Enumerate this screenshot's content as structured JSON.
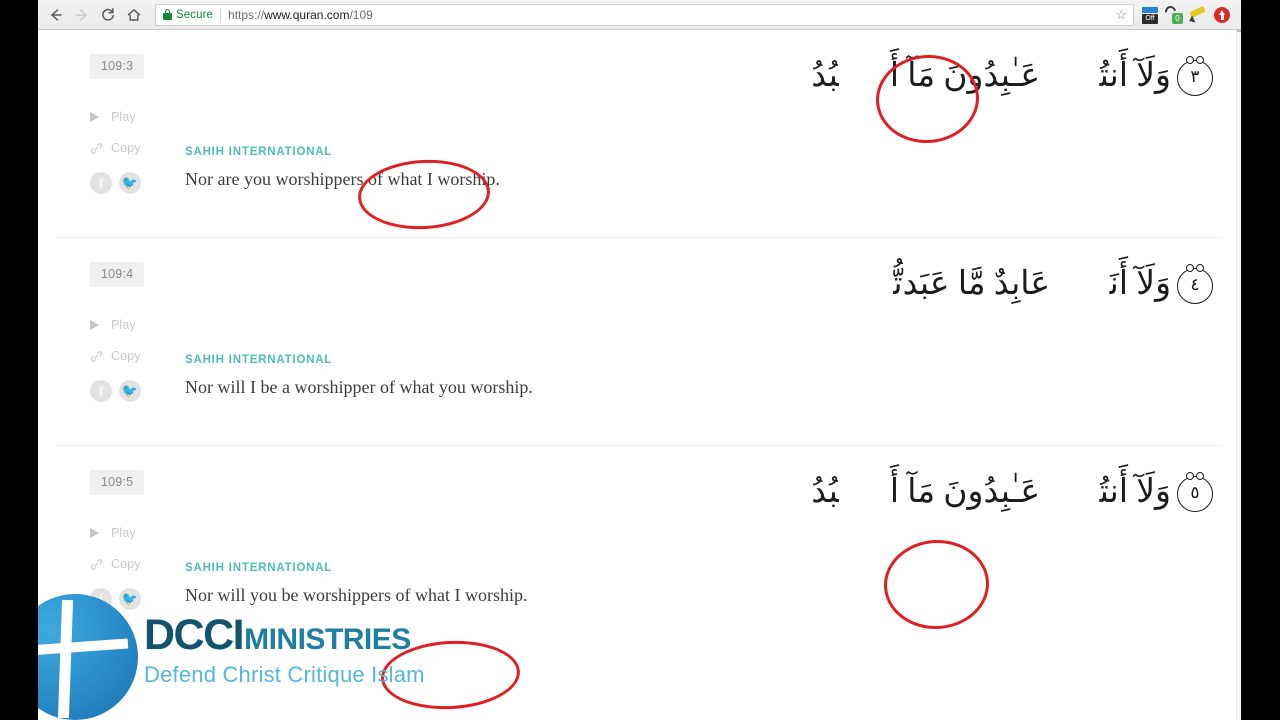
{
  "browser": {
    "back_label": "back-arrow",
    "forward_label": "forward-arrow",
    "reload_label": "reload",
    "home_label": "home",
    "security_label": "Secure",
    "url_scheme": "https://",
    "url_host": "www.quran.com",
    "url_path": "/109",
    "bookmark_star": "☆",
    "extensions": [
      {
        "name": "toggle-off-extension",
        "label": "Off"
      },
      {
        "name": "blocker-extension",
        "label": "0"
      },
      {
        "name": "pencil-extension",
        "label": ""
      },
      {
        "name": "upload-extension",
        "label": ""
      }
    ]
  },
  "page": {
    "verses": [
      {
        "number": "109:3",
        "play_label": "Play",
        "copy_label": "Copy",
        "facebook_label": "f",
        "twitter_label": "🐦",
        "arabic": "وَلَآ أَنتُمۡ عَـٰبِدُونَ مَآ أَعۡبُدُ",
        "ayah_mark": "٣",
        "translator": "SAHIH INTERNATIONAL",
        "translation": "Nor are you worshippers of what I worship.",
        "annotated": true
      },
      {
        "number": "109:4",
        "play_label": "Play",
        "copy_label": "Copy",
        "facebook_label": "f",
        "twitter_label": "🐦",
        "arabic": "وَلَآ أَنَا۠ عَابِدٌ مَّا عَبَدتُّمۡ",
        "ayah_mark": "٤",
        "translator": "SAHIH INTERNATIONAL",
        "translation": "Nor will I be a worshipper of what you worship.",
        "annotated": false
      },
      {
        "number": "109:5",
        "play_label": "Play",
        "copy_label": "Copy",
        "facebook_label": "f",
        "twitter_label": "🐦",
        "arabic": "وَلَآ أَنتُمۡ عَـٰبِدُونَ مَآ أَعۡبُدُ",
        "ayah_mark": "٥",
        "translator": "SAHIH INTERNATIONAL",
        "translation": "Nor will you be worshippers of what I worship.",
        "annotated": true
      }
    ]
  },
  "watermark": {
    "brand": "DCCI",
    "brand_suffix": "MINISTRIES",
    "tagline": "Defend Christ Critique Islam"
  },
  "colors": {
    "accent_teal": "#4bbfb0",
    "annotation_red": "#e02020",
    "secure_green": "#0f8a3c",
    "brand_dark": "#12556b",
    "brand_mid": "#1f7fa0",
    "brand_light": "#56b4e0"
  }
}
